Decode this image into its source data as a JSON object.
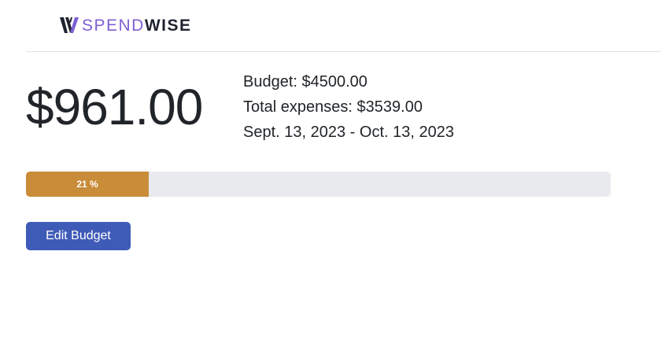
{
  "brand": {
    "name_part1": "SPEND",
    "name_part2": "WISE",
    "logo_icon": "spendwise-w-logo-icon",
    "accent_color": "#7d5fd6",
    "dark_color": "#1f2330"
  },
  "summary": {
    "remaining": "$961.00",
    "budget": "Budget: $4500.00",
    "total_expenses": "Total expenses: $3539.00",
    "period": "Sept. 13, 2023 - Oct. 13, 2023"
  },
  "progress": {
    "label": "21 %",
    "fraction": 0.21,
    "fill_color": "#c98c39"
  },
  "actions": {
    "edit_budget_label": "Edit Budget",
    "button_color": "#3f5bb8"
  }
}
